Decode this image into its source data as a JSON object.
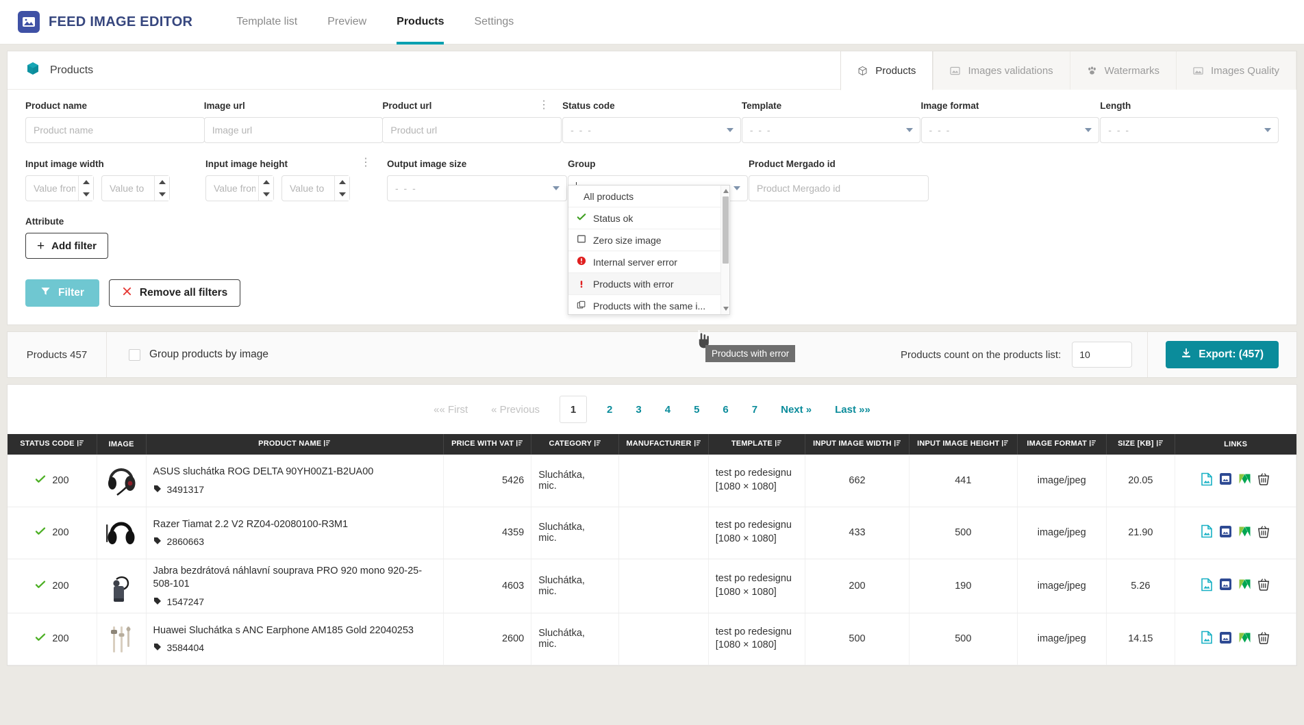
{
  "navbar": {
    "brand": "FEED IMAGE EDITOR",
    "logo_icon": "image-logo-icon",
    "tabs": [
      {
        "label": "Template list",
        "active": false
      },
      {
        "label": "Preview",
        "active": false
      },
      {
        "label": "Products",
        "active": true
      },
      {
        "label": "Settings",
        "active": false
      }
    ]
  },
  "panel": {
    "title": "Products",
    "title_icon": "cube-icon",
    "module_tabs": [
      {
        "label": "Products",
        "icon": "cube-icon",
        "active": true
      },
      {
        "label": "Images validations",
        "icon": "image-check-icon",
        "active": false
      },
      {
        "label": "Watermarks",
        "icon": "paw-icon",
        "active": false
      },
      {
        "label": "Images Quality",
        "icon": "picture-icon",
        "active": false
      }
    ]
  },
  "filters": {
    "product_name": {
      "label": "Product name",
      "placeholder": "Product name",
      "value": ""
    },
    "image_url": {
      "label": "Image url",
      "placeholder": "Image url",
      "value": ""
    },
    "product_url": {
      "label": "Product url",
      "placeholder": "Product url",
      "value": "",
      "menu_icon": "vertical-dots-icon"
    },
    "status_code": {
      "label": "Status code",
      "value": "- - -"
    },
    "template": {
      "label": "Template",
      "value": "- - -"
    },
    "image_format": {
      "label": "Image format",
      "value": "- - -"
    },
    "length": {
      "label": "Length",
      "value": "- - -"
    },
    "input_image_width": {
      "label": "Input image width",
      "from_placeholder": "Value from",
      "to_placeholder": "Value to"
    },
    "input_image_height": {
      "label": "Input image height",
      "from_placeholder": "Value from",
      "to_placeholder": "Value to",
      "menu_icon": "vertical-dots-icon"
    },
    "output_image_size": {
      "label": "Output image size",
      "value": "- - -"
    },
    "group": {
      "label": "Group",
      "value": ""
    },
    "product_mergado_id": {
      "label": "Product Mergado id",
      "placeholder": "Product Mergado id",
      "value": ""
    },
    "attribute": {
      "label": "Attribute"
    },
    "add_filter_label": "Add filter",
    "filter_button": "Filter",
    "remove_all_label": "Remove all filters"
  },
  "group_dropdown": {
    "open": true,
    "tooltip": "Products with error",
    "items": [
      {
        "label": "All products",
        "icon": "none"
      },
      {
        "label": "Status ok",
        "icon": "green-check-icon"
      },
      {
        "label": "Zero size image",
        "icon": "empty-square-icon"
      },
      {
        "label": "Internal server error",
        "icon": "red-alert-circle-icon"
      },
      {
        "label": "Products with error",
        "icon": "red-exclamation-icon",
        "hovered": true
      },
      {
        "label": "Products with the same i...",
        "icon": "copy-icon"
      }
    ]
  },
  "countbar": {
    "products_count_label": "Products 457",
    "group_by_image_label": "Group products by image",
    "group_by_image_checked": false,
    "count_on_list_label": "Products count on the products list:",
    "count_on_list_value": "10",
    "export_label": "Export: (457)",
    "export_icon": "download-icon"
  },
  "pagination": {
    "first": "«« First",
    "previous": "« Previous",
    "pages": [
      "1",
      "2",
      "3",
      "4",
      "5",
      "6",
      "7"
    ],
    "current": "1",
    "next": "Next »",
    "last": "Last »»"
  },
  "table": {
    "columns": [
      {
        "label": "Status code",
        "sortable": true
      },
      {
        "label": "Image",
        "sortable": false
      },
      {
        "label": "Product name",
        "sortable": true
      },
      {
        "label": "Price with VAT",
        "sortable": true
      },
      {
        "label": "Category",
        "sortable": true
      },
      {
        "label": "Manufacturer",
        "sortable": true
      },
      {
        "label": "Template",
        "sortable": true
      },
      {
        "label": "Input image width",
        "sortable": true
      },
      {
        "label": "Input image height",
        "sortable": true
      },
      {
        "label": "Image format",
        "sortable": true
      },
      {
        "label": "Size [kB]",
        "sortable": true
      },
      {
        "label": "Links",
        "sortable": false
      }
    ],
    "rows": [
      {
        "status": "200",
        "thumb": "headset-asus",
        "name": "ASUS sluchátka ROG DELTA 90YH00Z1-B2UA00",
        "pid": "3491317",
        "price": "5426",
        "category": "Sluchátka, mic.",
        "manufacturer": "",
        "template": "test po redesignu",
        "template_size": "[1080 × 1080]",
        "width": "662",
        "height": "441",
        "format": "image/jpeg",
        "size_kb": "20.05"
      },
      {
        "status": "200",
        "thumb": "headset-razer",
        "name": "Razer Tiamat 2.2 V2 RZ04-02080100-R3M1",
        "pid": "2860663",
        "price": "4359",
        "category": "Sluchátka, mic.",
        "manufacturer": "",
        "template": "test po redesignu",
        "template_size": "[1080 × 1080]",
        "width": "433",
        "height": "500",
        "format": "image/jpeg",
        "size_kb": "21.90"
      },
      {
        "status": "200",
        "thumb": "headset-jabra",
        "name": "Jabra bezdrátová náhlavní souprava PRO 920 mono 920-25-508-101",
        "pid": "1547247",
        "price": "4603",
        "category": "Sluchátka, mic.",
        "manufacturer": "",
        "template": "test po redesignu",
        "template_size": "[1080 × 1080]",
        "width": "200",
        "height": "190",
        "format": "image/jpeg",
        "size_kb": "5.26"
      },
      {
        "status": "200",
        "thumb": "earphone-huawei",
        "name": "Huawei Sluchátka s ANC Earphone AM185 Gold 22040253",
        "pid": "3584404",
        "price": "2600",
        "category": "Sluchátka, mic.",
        "manufacturer": "",
        "template": "test po redesignu",
        "template_size": "[1080 × 1080]",
        "width": "500",
        "height": "500",
        "format": "image/jpeg",
        "size_kb": "14.15"
      }
    ],
    "row_link_icons": [
      "image-file-icon",
      "image-edit-icon",
      "mergado-icon",
      "delete-basket-icon"
    ]
  },
  "colors": {
    "brand_navy": "#36467e",
    "teal": "#0b8c9b",
    "teal_light": "#6fc7d1",
    "accent_underline": "#00a0b0",
    "header_dark": "#2e2e2e",
    "status_green": "#4caf24",
    "error_red": "#d32f2f"
  }
}
